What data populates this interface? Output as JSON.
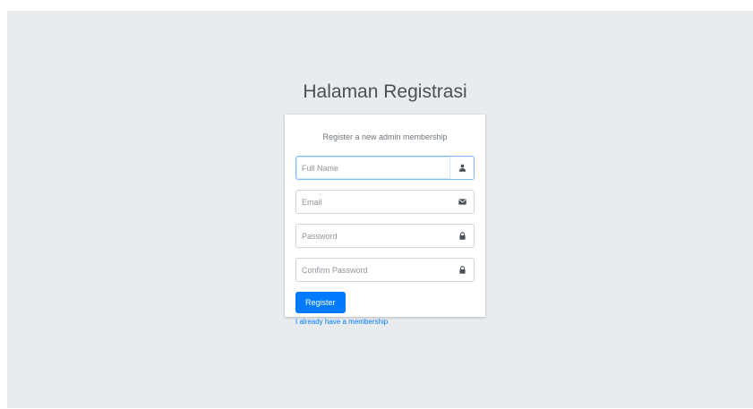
{
  "logo": {
    "title": "Halaman Registrasi"
  },
  "card": {
    "message": "Register a new admin membership",
    "fields": {
      "full_name": {
        "placeholder": "Full Name",
        "icon": "user-icon"
      },
      "email": {
        "placeholder": "Email",
        "icon": "envelope-icon"
      },
      "password": {
        "placeholder": "Password",
        "icon": "lock-icon"
      },
      "confirm_password": {
        "placeholder": "Confirm Password",
        "icon": "lock-icon"
      }
    },
    "register_label": "Register",
    "membership_link": "I already have a membership"
  },
  "colors": {
    "background": "#e9ecef",
    "primary": "#007bff",
    "focus_border": "#80bdff"
  }
}
